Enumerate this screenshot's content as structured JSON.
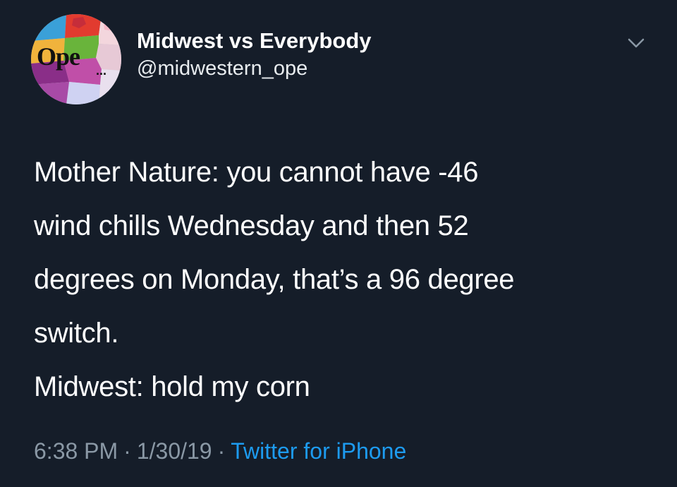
{
  "tweet": {
    "author": {
      "display_name": "Midwest vs Everybody",
      "handle": "@midwestern_ope",
      "avatar_text": "Ope...",
      "avatar_icon": "midwest-map-avatar"
    },
    "menu_icon": "chevron-down-icon",
    "body_lines": [
      "Mother Nature: you cannot have -46",
      "wind chills Wednesday and then 52",
      "degrees on Monday, that’s a 96 degree",
      "switch.",
      "Midwest: hold my corn"
    ],
    "time": "6:38 PM",
    "date": "1/30/19",
    "separator": "·",
    "source": "Twitter for iPhone"
  },
  "colors": {
    "background": "#151d29",
    "text": "#ffffff",
    "muted": "#8a98a5",
    "link": "#1d9bf0"
  }
}
